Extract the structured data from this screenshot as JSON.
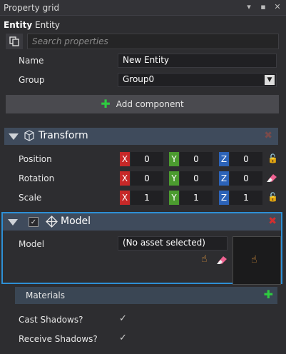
{
  "window": {
    "title": "Property grid",
    "controls": [
      "▾",
      "▪",
      "✕"
    ]
  },
  "entity": {
    "type_bold": "Entity",
    "name": "Entity"
  },
  "search": {
    "placeholder": "Search properties"
  },
  "props": {
    "name_label": "Name",
    "name_value": "New Entity",
    "group_label": "Group",
    "group_value": "Group0"
  },
  "add_component": {
    "label": "Add component"
  },
  "transform": {
    "title": "Transform",
    "rows": [
      {
        "label": "Position",
        "x": "0",
        "y": "0",
        "z": "0"
      },
      {
        "label": "Rotation",
        "x": "0",
        "y": "0",
        "z": "0"
      },
      {
        "label": "Scale",
        "x": "1",
        "y": "1",
        "z": "1"
      }
    ],
    "axis_letters": {
      "x": "X",
      "y": "Y",
      "z": "Z"
    }
  },
  "model": {
    "title": "Model",
    "prop_label": "Model",
    "asset_value": "(No asset selected)"
  },
  "materials": {
    "label": "Materials"
  },
  "shadows": {
    "cast_label": "Cast Shadows?",
    "receive_label": "Receive Shadows?",
    "cast_checked": true,
    "receive_checked": true
  },
  "colors": {
    "accent": "#2d8fd5",
    "x": "#c62828",
    "y": "#4b9b2f",
    "z": "#2c63b8"
  }
}
